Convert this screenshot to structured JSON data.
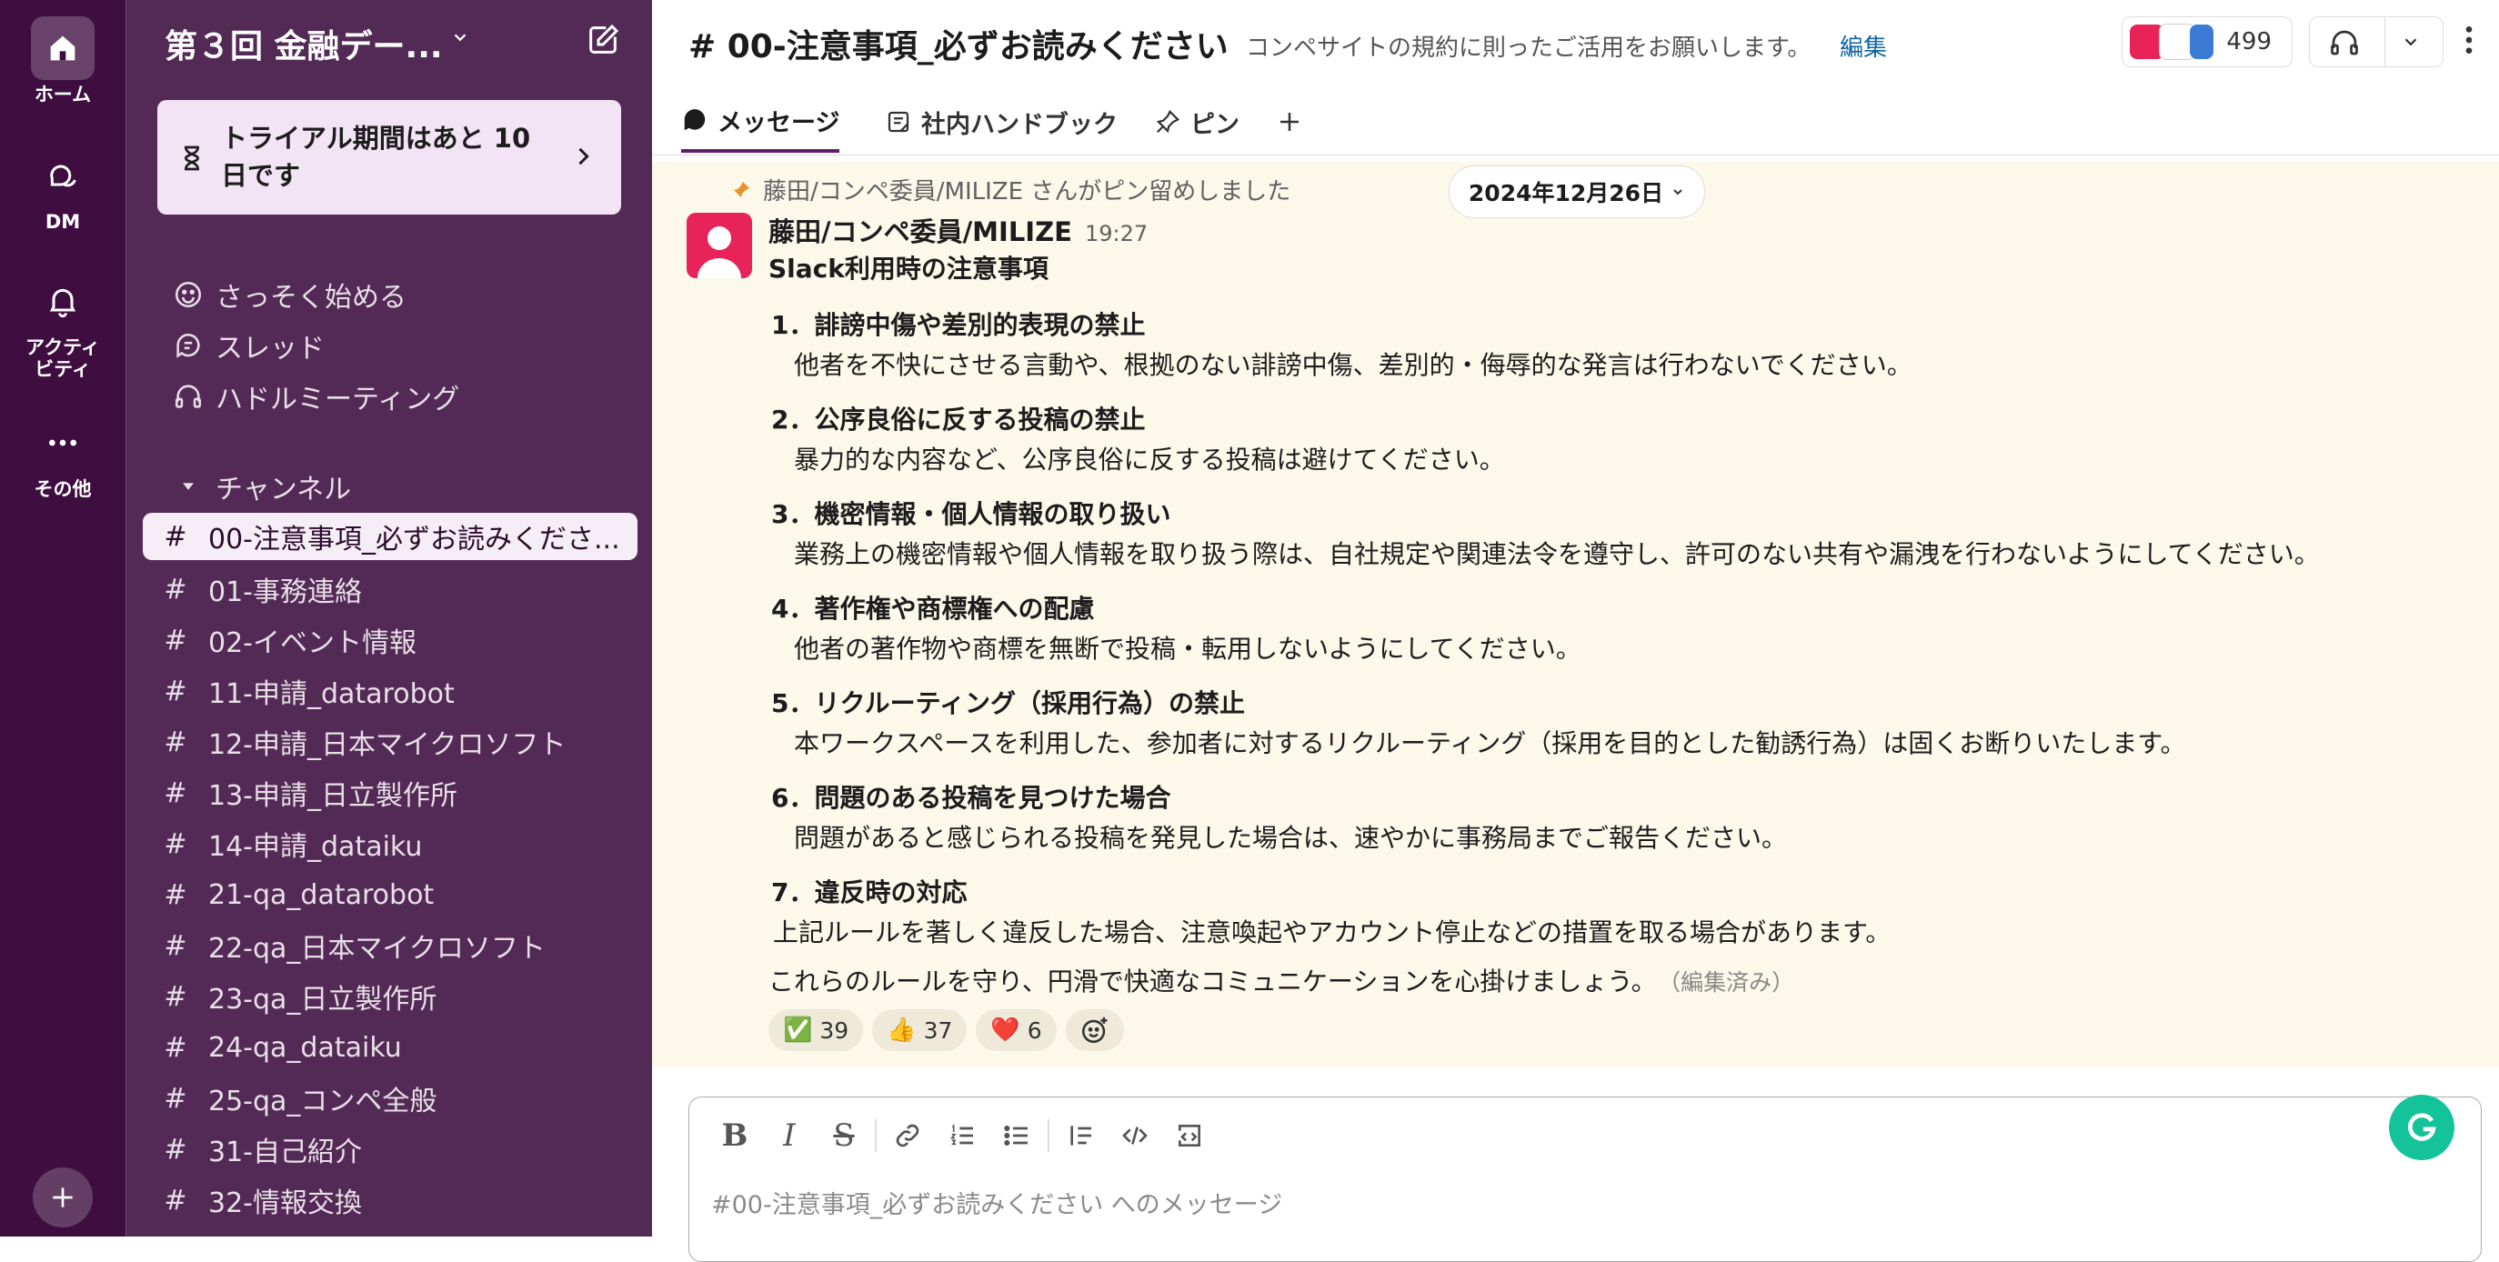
{
  "rail": {
    "home": "ホーム",
    "dm": "DM",
    "activity_line1": "アクティ",
    "activity_line2": "ビティ",
    "more": "その他"
  },
  "workspace": {
    "name": "第３回 金融デー...",
    "trial_text": "トライアル期間はあと 10 日です"
  },
  "nav": [
    {
      "label": "さっそく始める",
      "icon": "smile-icon"
    },
    {
      "label": "スレッド",
      "icon": "threads-icon"
    },
    {
      "label": "ハドルミーティング",
      "icon": "headphones-icon"
    }
  ],
  "channels_section": "チャンネル",
  "channels": [
    "00-注意事項_必ずお読みくださ...",
    "01-事務連絡",
    "02-イベント情報",
    "11-申請_datarobot",
    "12-申請_日本マイクロソフト",
    "13-申請_日立製作所",
    "14-申請_dataiku",
    "21-qa_datarobot",
    "22-qa_日本マイクロソフト",
    "23-qa_日立製作所",
    "24-qa_dataiku",
    "25-qa_コンペ全般",
    "31-自己紹介",
    "32-情報交換"
  ],
  "header": {
    "title": "# 00-注意事項_必ずお読みください",
    "topic": "コンペサイトの規約に則ったご活用をお願いします。",
    "edit": "編集",
    "member_count": "499"
  },
  "tabs": [
    {
      "label": "メッセージ",
      "icon": "message-icon"
    },
    {
      "label": "社内ハンドブック",
      "icon": "canvas-icon"
    },
    {
      "label": "ピン",
      "icon": "pin-icon"
    }
  ],
  "message": {
    "pinned_note": "藤田/コンペ委員/MILIZE さんがピン留めしました",
    "date": "2024年12月26日",
    "author": "藤田/コンペ委員/MILIZE",
    "time": "19:27",
    "title": "Slack利用時の注意事項",
    "rules": [
      {
        "heading": "1．誹謗中傷や差別的表現の禁止",
        "text": "他者を不快にさせる言動や、根拠のない誹謗中傷、差別的・侮辱的な発言は行わないでください。"
      },
      {
        "heading": "2．公序良俗に反する投稿の禁止",
        "text": "暴力的な内容など、公序良俗に反する投稿は避けてください。"
      },
      {
        "heading": "3．機密情報・個人情報の取り扱い",
        "text": "業務上の機密情報や個人情報を取り扱う際は、自社規定や関連法令を遵守し、許可のない共有や漏洩を行わないようにしてください。"
      },
      {
        "heading": "4．著作権や商標権への配慮",
        "text": "他者の著作物や商標を無断で投稿・転用しないようにしてください。"
      },
      {
        "heading": "5．リクルーティング（採用行為）の禁止",
        "text": "本ワークスペースを利用した、参加者に対するリクルーティング（採用を目的とした勧誘行為）は固くお断りいたします。"
      },
      {
        "heading": "6．問題のある投稿を見つけた場合",
        "text": "問題があると感じられる投稿を発見した場合は、速やかに事務局までご報告ください。"
      },
      {
        "heading": "7．違反時の対応",
        "text": "上記ルールを著しく違反した場合、注意喚起やアカウント停止などの措置を取る場合があります。"
      }
    ],
    "closing": "これらのルールを守り、円滑で快適なコミュニケーションを心掛けましょう。",
    "edited": "（編集済み）",
    "reactions": [
      {
        "emoji": "✅",
        "count": "39"
      },
      {
        "emoji": "👍",
        "count": "37"
      },
      {
        "emoji": "❤️",
        "count": "6"
      }
    ]
  },
  "composer": {
    "placeholder": "#00-注意事項_必ずお読みください へのメッセージ"
  }
}
